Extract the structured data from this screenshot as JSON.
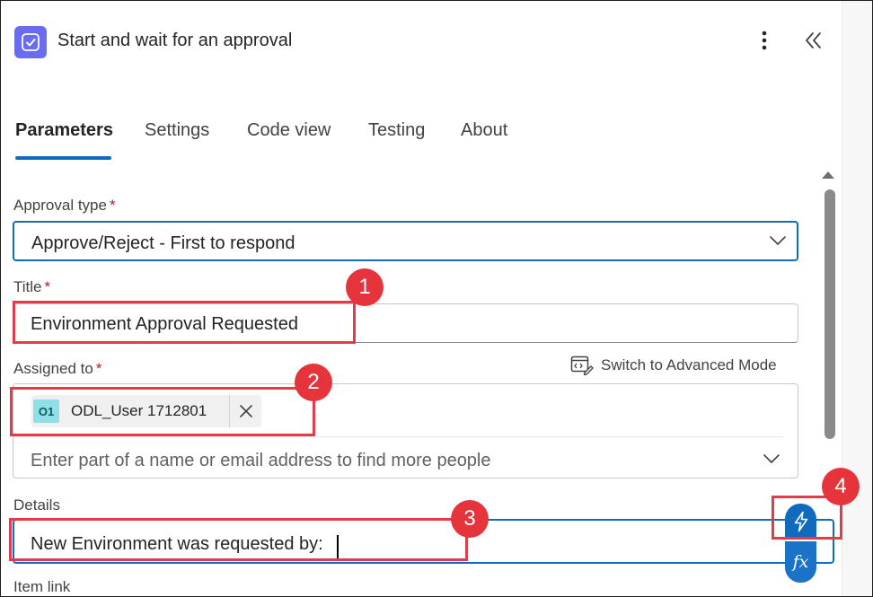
{
  "header": {
    "title": "Start and wait for an approval",
    "icon": "approval-icon",
    "more_icon": "more-vertical-icon",
    "collapse_icon": "double-chevron-left-icon"
  },
  "tabs": [
    {
      "label": "Parameters",
      "active": true
    },
    {
      "label": "Settings",
      "active": false
    },
    {
      "label": "Code view",
      "active": false
    },
    {
      "label": "Testing",
      "active": false
    },
    {
      "label": "About",
      "active": false
    }
  ],
  "fields": {
    "approval_type": {
      "label": "Approval type",
      "required_mark": "*",
      "value": "Approve/Reject - First to respond"
    },
    "title": {
      "label": "Title",
      "required_mark": "*",
      "value": "Environment Approval Requested"
    },
    "assigned_to": {
      "label": "Assigned to",
      "required_mark": "*",
      "advanced_mode_label": "Switch to Advanced Mode",
      "chip": {
        "initials": "O1",
        "name": "ODL_User 1712801"
      },
      "placeholder": "Enter part of a name or email address to find more people"
    },
    "details": {
      "label": "Details",
      "value": "New Environment was requested by:"
    },
    "item_link": {
      "label": "Item link"
    }
  },
  "buttons": {
    "dynamic_content_icon": "lightning-icon",
    "expression_label": "fx"
  },
  "annotations": [
    "1",
    "2",
    "3",
    "4"
  ],
  "colors": {
    "accent": "#0f6cbd",
    "app_icon_bg": "#6a6cf0",
    "highlight": "#e23b4a",
    "required": "#c50f1f"
  }
}
